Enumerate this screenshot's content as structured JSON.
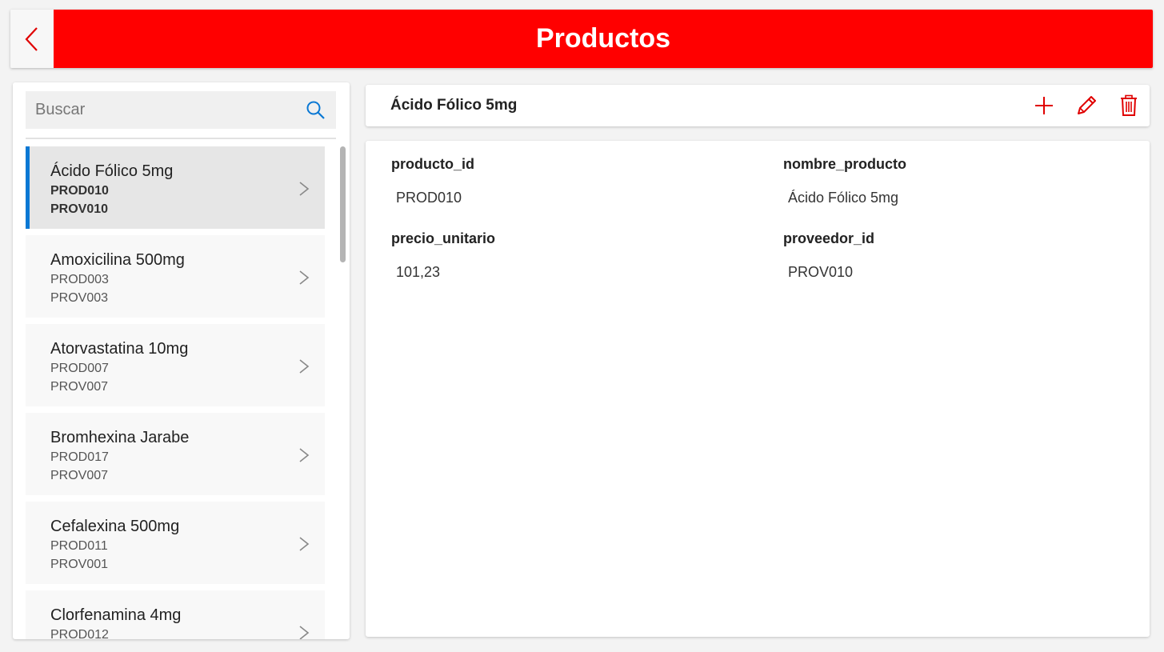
{
  "header": {
    "title": "Productos",
    "back_icon": "chevron-left-icon",
    "accent_color": "#ff0000"
  },
  "search": {
    "placeholder": "Buscar",
    "value": "",
    "icon": "search-icon",
    "icon_color": "#0a78d4"
  },
  "list": {
    "selected_index": 0,
    "selection_color": "#0a78d4",
    "items": [
      {
        "name": "Ácido Fólico 5mg",
        "product_id": "PROD010",
        "provider_id": "PROV010"
      },
      {
        "name": "Amoxicilina 500mg",
        "product_id": "PROD003",
        "provider_id": "PROV003"
      },
      {
        "name": "Atorvastatina 10mg",
        "product_id": "PROD007",
        "provider_id": "PROV007"
      },
      {
        "name": "Bromhexina Jarabe",
        "product_id": "PROD017",
        "provider_id": "PROV007"
      },
      {
        "name": "Cefalexina 500mg",
        "product_id": "PROD011",
        "provider_id": "PROV001"
      },
      {
        "name": "Clorfenamina 4mg",
        "product_id": "PROD012",
        "provider_id": ""
      }
    ]
  },
  "detail": {
    "title": "Ácido Fólico 5mg",
    "actions": {
      "add_icon": "plus-icon",
      "edit_icon": "pencil-icon",
      "delete_icon": "trash-icon"
    },
    "fields": {
      "producto_id": {
        "label": "producto_id",
        "value": "PROD010"
      },
      "nombre_producto": {
        "label": "nombre_producto",
        "value": "Ácido Fólico 5mg"
      },
      "precio_unitario": {
        "label": "precio_unitario",
        "value": "101,23"
      },
      "proveedor_id": {
        "label": "proveedor_id",
        "value": "PROV010"
      }
    }
  }
}
